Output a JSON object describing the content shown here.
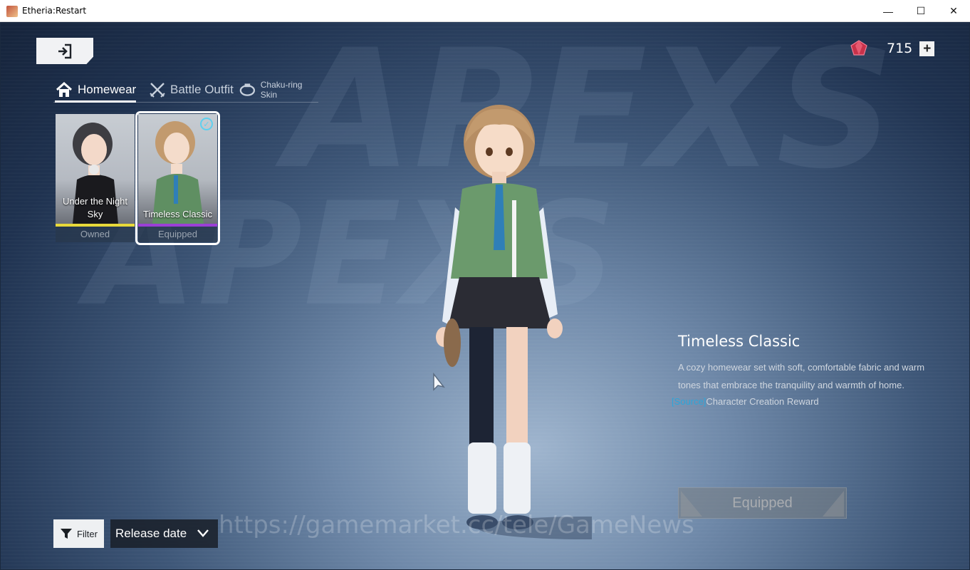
{
  "window": {
    "title": "Etheria:Restart",
    "minimize_glyph": "—",
    "maximize_glyph": "☐",
    "close_glyph": "✕"
  },
  "currency": {
    "icon": "red-gem-icon",
    "value": "715",
    "add_label": "+"
  },
  "tabs": [
    {
      "label": "Homewear",
      "icon": "home-icon",
      "active": true
    },
    {
      "label": "Battle Outfit",
      "icon": "crossed-swords-icon",
      "active": false
    },
    {
      "label": "Chaku-ring Skin",
      "icon": "ring-icon",
      "active": false
    }
  ],
  "outfits": [
    {
      "name": "Under the Night Sky",
      "status": "Owned",
      "rarity_color": "#e8d93a",
      "selected": false
    },
    {
      "name": "Timeless Classic",
      "status": "Equipped",
      "rarity_color": "#9b3fd6",
      "selected": true
    }
  ],
  "detail": {
    "title": "Timeless Classic",
    "description": "A cozy homewear set with soft, comfortable fabric and warm tones that embrace the tranquility and warmth of home.",
    "source_tag": "[Source]",
    "source_text": "Character Creation Reward",
    "equip_label": "Equipped"
  },
  "bottom_bar": {
    "filter_label": "Filter",
    "sort_value": "Release date"
  },
  "watermark": "https://gamemarket.cc/tele/GameNews",
  "background_text": [
    "APEXS",
    "APEXS"
  ],
  "colors": {
    "source_tag": "#2ea5d9",
    "check_badge": "#5ed0ef",
    "rarity_gold": "#e8d93a",
    "rarity_purple": "#9b3fd6"
  }
}
